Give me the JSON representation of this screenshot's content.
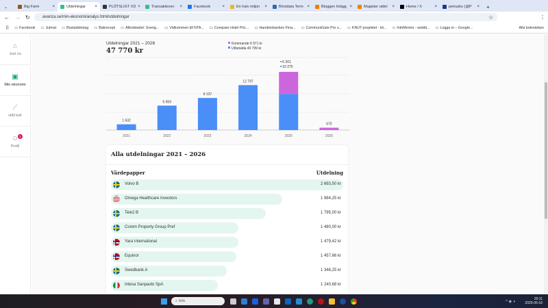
{
  "browser": {
    "tabs": [
      {
        "label": "Big Farm",
        "color": "#8a5a2a",
        "active": false
      },
      {
        "label": "Utdelningar",
        "color": "#3dbb8a",
        "active": true
      },
      {
        "label": "PLÖTSLIGT VD",
        "color": "#333333",
        "active": false
      },
      {
        "label": "Transaktioner",
        "color": "#3dbb8a",
        "active": false
      },
      {
        "label": "Facebook",
        "color": "#1877f2",
        "active": false
      },
      {
        "label": "En halv miljon",
        "color": "#f0b429",
        "active": false
      },
      {
        "label": "Börsdata Term",
        "color": "#2b6cb0",
        "active": false
      },
      {
        "label": "Bloggen Inlägg",
        "color": "#f57c00",
        "active": false
      },
      {
        "label": "Magister utdel",
        "color": "#f57c00",
        "active": false
      },
      {
        "label": "Home / X",
        "color": "#000000",
        "active": false
      },
      {
        "label": "petrusko (@P",
        "color": "#1a3a8a",
        "active": false
      }
    ],
    "url": "avanza.se/min-ekonomi/analys.html/utdelningar",
    "bookmarks": [
      "Facebook",
      "Julmat",
      "Bostadsbolag",
      "Bakrecept",
      "Aftonbladet: Sverig...",
      "Välkommen till NTA...",
      "Compare Hotel Pric...",
      "Handelsbanken Fina...",
      "CommuniGate Pro s...",
      "KNUT-projektet - kli...",
      "InfoMentor - webbl...",
      "Logga in – Google..."
    ],
    "all_bookmarks": "Alla bokmärken"
  },
  "sidebar": {
    "items": [
      {
        "label": "Just nu",
        "icon": "home-icon"
      },
      {
        "label": "Min ekonomi",
        "icon": "briefcase-icon"
      },
      {
        "label": "Håll koll",
        "icon": "chart-icon"
      },
      {
        "label": "Profil",
        "icon": "profile-icon",
        "badge": "1"
      }
    ]
  },
  "chart_data": {
    "type": "bar",
    "title": "Utdelningar 2021 – 2026",
    "total": "47 770 kr",
    "legend": [
      {
        "label": "Kommande 6 971 kr",
        "color": "#cc66dd"
      },
      {
        "label": "Utbetalda 40 799 kr",
        "color": "#4a8ef8"
      }
    ],
    "categories": [
      "2021",
      "2022",
      "2023",
      "2024",
      "2025",
      "2026"
    ],
    "series": [
      {
        "name": "Utbetalda",
        "color": "#4a8ef8",
        "values": [
          1632,
          6959,
          9137,
          12797,
          10275,
          0
        ]
      },
      {
        "name": "Kommande",
        "color": "#cc66dd",
        "values": [
          0,
          0,
          0,
          0,
          6301,
          670
        ]
      }
    ],
    "labels": [
      "1 632",
      "6 959",
      "9 137",
      "12 797",
      "",
      "670"
    ],
    "stack_labels": {
      "kommande": "6 301",
      "utbetalda": "10 275"
    },
    "ylim": [
      0,
      20000
    ]
  },
  "table": {
    "title": "Alla utdelningar 2021 – 2026",
    "col_security": "Värdepapper",
    "col_dividend": "Utdelning",
    "rows": [
      {
        "name": "Volvo B",
        "value": "2 693,50 kr",
        "amount": 2693.5,
        "flag": "se"
      },
      {
        "name": "Omega Healthcare Investors",
        "value": "1 984,25 kr",
        "amount": 1984.25,
        "flag": "us"
      },
      {
        "name": "Tele2 B",
        "value": "1 795,00 kr",
        "amount": 1795,
        "flag": "se"
      },
      {
        "name": "Corem Property Group Pref",
        "value": "1 480,00 kr",
        "amount": 1480,
        "flag": "se"
      },
      {
        "name": "Yara International",
        "value": "1 479,42 kr",
        "amount": 1479.42,
        "flag": "no"
      },
      {
        "name": "Equinor",
        "value": "1 457,66 kr",
        "amount": 1457.66,
        "flag": "no"
      },
      {
        "name": "Swedbank A",
        "value": "1 346,25 kr",
        "amount": 1346.25,
        "flag": "se"
      },
      {
        "name": "Intesa Sanpaolo SpA",
        "value": "1 240,68 kr",
        "amount": 1240.68,
        "flag": "it"
      }
    ]
  },
  "taskbar": {
    "search": "Sök",
    "time": "20:11",
    "date": "2025-05-16"
  }
}
